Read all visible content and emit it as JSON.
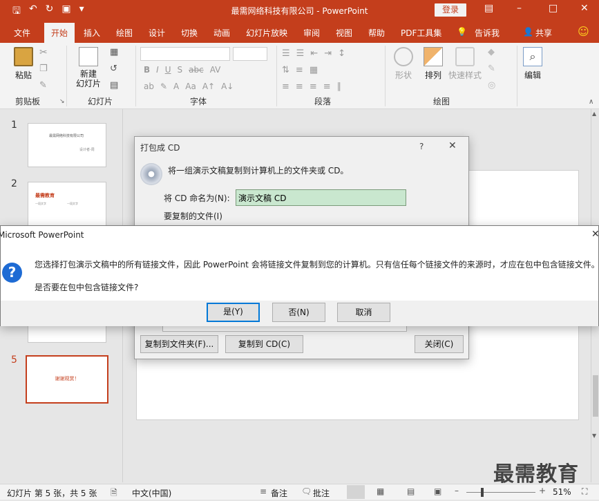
{
  "app": {
    "window_title": "最需网络科技有限公司  -  PowerPoint",
    "login_label": "登录",
    "colors": {
      "accent": "#c43e1c",
      "dialog_bg": "#f0f0f0",
      "input_bg": "#c9e7cf",
      "help_blue": "#1e6bd4"
    }
  },
  "tabs": [
    "文件",
    "开始",
    "插入",
    "绘图",
    "设计",
    "切换",
    "动画",
    "幻灯片放映",
    "审阅",
    "视图",
    "帮助",
    "PDF工具集",
    "告诉我",
    "共享"
  ],
  "ribbon": {
    "clipboard": {
      "paste": "粘贴",
      "group": "剪贴板"
    },
    "slides": {
      "new_slide": "新建\n幻灯片",
      "group": "幻灯片"
    },
    "font": {
      "group": "字体"
    },
    "paragraph": {
      "group": "段落"
    },
    "drawing": {
      "shapes": "形状",
      "arrange": "排列",
      "quick_styles": "快速样式",
      "group": "绘图"
    },
    "editing": {
      "label": "编辑"
    }
  },
  "slides": [
    {
      "num": "1",
      "title": "最需网络科技有限公司",
      "subtitle": "设计者-周"
    },
    {
      "num": "2",
      "title": "最需教育",
      "bullets": [
        "一段文字",
        "一段文字"
      ]
    },
    {
      "num": "5",
      "text": "谢谢观赏！"
    }
  ],
  "package_dialog": {
    "title": "打包成 CD",
    "help": "?",
    "description": "将一组演示文稿复制到计算机上的文件夹或 CD。",
    "name_label": "将 CD 命名为(N):",
    "name_value": "演示文稿 CD",
    "files_label": "要复制的文件(I)",
    "copy_folder_btn": "复制到文件夹(F)...",
    "copy_cd_btn": "复制到 CD(C)",
    "close_btn": "关闭(C)"
  },
  "confirm_dialog": {
    "title": "Microsoft PowerPoint",
    "message": "您选择打包演示文稿中的所有链接文件，因此 PowerPoint 会将链接文件复制到您的计算机。只有信任每个链接文件的来源时，才应在包中包含链接文件。",
    "question": "是否要在包中包含链接文件?",
    "yes": "是(Y)",
    "no": "否(N)",
    "cancel": "取消"
  },
  "status": {
    "slide_info": "幻灯片 第 5 张，共 5 张",
    "language": "中文(中国)",
    "notes": "备注",
    "comments": "批注",
    "zoom": "51%"
  },
  "watermark": "最需教育"
}
